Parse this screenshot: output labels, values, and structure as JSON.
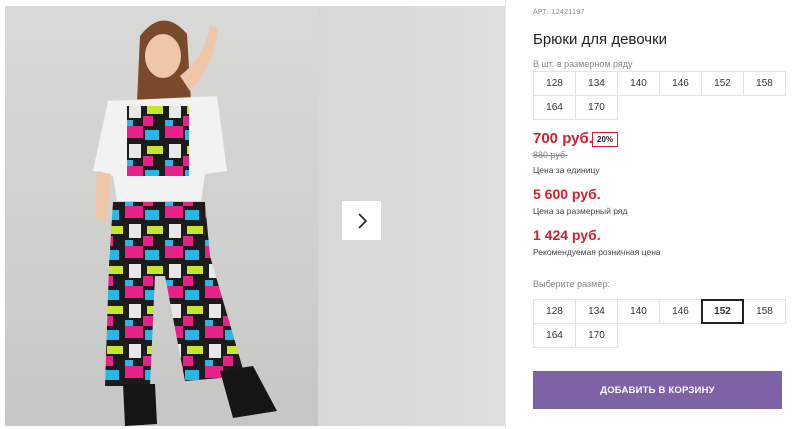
{
  "product": {
    "article_label": "АРТ.",
    "article_number": "12421197",
    "title": "Брюки для девочки"
  },
  "pack_sizes": {
    "label": "В шт. в размерном ряду",
    "sizes": [
      "128",
      "134",
      "140",
      "146",
      "152",
      "158",
      "164",
      "170"
    ]
  },
  "pricing": {
    "price": "700 руб.",
    "discount": "20%",
    "old_price": "880 руб.",
    "price_unit_note": "Цена за единицу",
    "pack_price": "5 600 руб.",
    "pack_price_note": "Цена за размерный ряд",
    "retail_price": "1 424 руб.",
    "retail_price_note": "Рекомендуемая розничная цена"
  },
  "size_select": {
    "label": "Выберите размер:",
    "sizes": [
      "128",
      "134",
      "140",
      "146",
      "152",
      "158",
      "164",
      "170"
    ],
    "selected": "152"
  },
  "cart": {
    "add_label": "ДОБАВИТЬ В КОРЗИНУ"
  },
  "gallery": {
    "next_icon": "chevron-right-icon"
  },
  "colors": {
    "accent": "#7d63a6",
    "price": "#d0202c"
  }
}
